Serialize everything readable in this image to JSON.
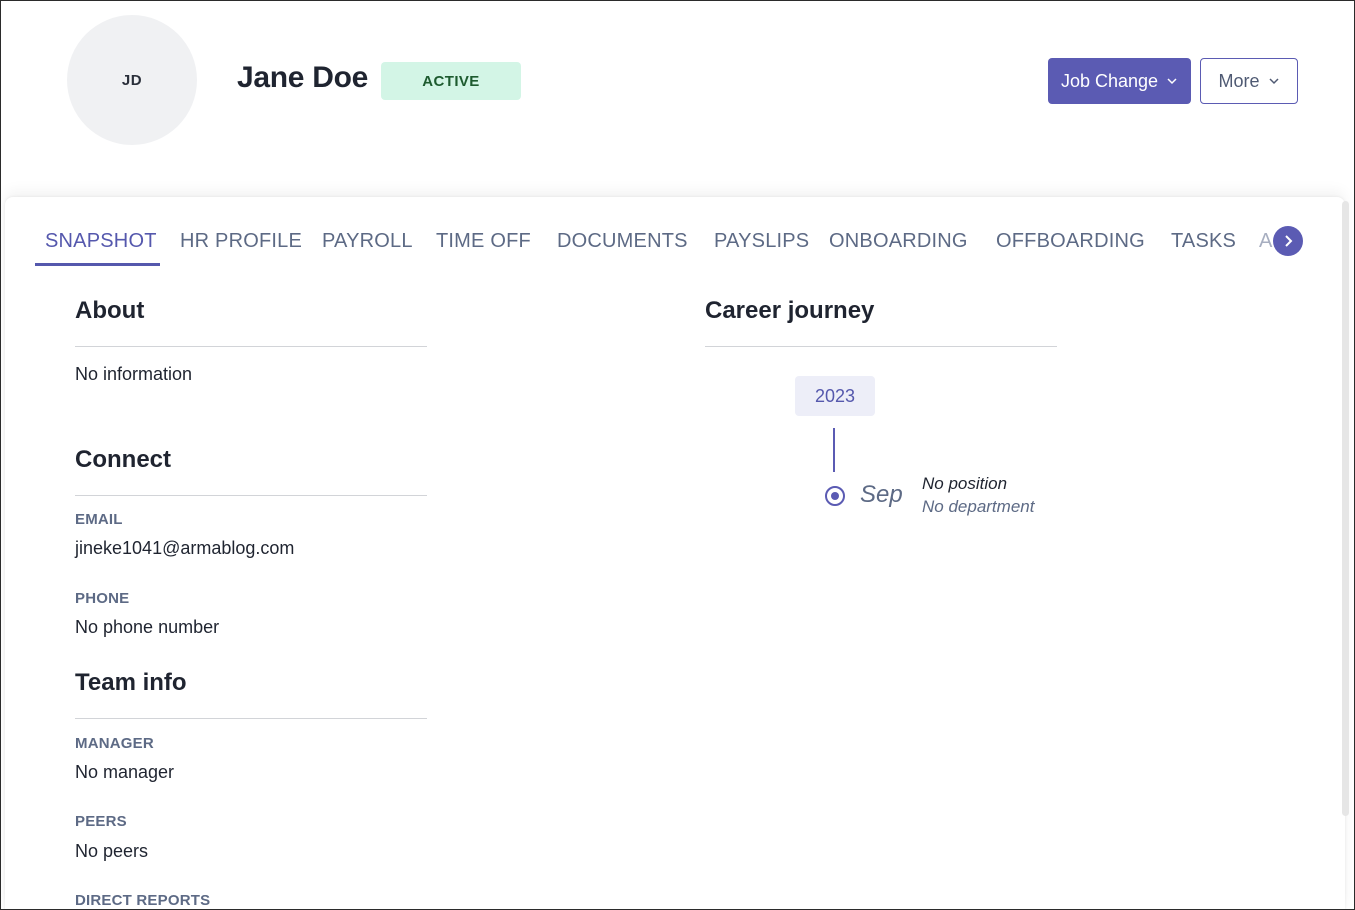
{
  "profile": {
    "initials": "JD",
    "name": "Jane Doe",
    "status": "ACTIVE",
    "status_color": "#d3f5e6",
    "accent_color": "#5b5bb3"
  },
  "actions": {
    "job_change_label": "Job Change",
    "more_label": "More"
  },
  "tabs": [
    {
      "label": "SNAPSHOT",
      "active": true
    },
    {
      "label": "HR PROFILE",
      "active": false
    },
    {
      "label": "PAYROLL",
      "active": false
    },
    {
      "label": "TIME OFF",
      "active": false
    },
    {
      "label": "DOCUMENTS",
      "active": false
    },
    {
      "label": "PAYSLIPS",
      "active": false
    },
    {
      "label": "ONBOARDING",
      "active": false
    },
    {
      "label": "OFFBOARDING",
      "active": false
    },
    {
      "label": "TASKS",
      "active": false
    },
    {
      "label": "A",
      "active": false
    }
  ],
  "about": {
    "title": "About",
    "text": "No information"
  },
  "connect": {
    "title": "Connect",
    "email_label": "EMAIL",
    "email_value": "jineke1041@armablog.com",
    "phone_label": "PHONE",
    "phone_value": "No phone number"
  },
  "team": {
    "title": "Team info",
    "manager_label": "MANAGER",
    "manager_value": "No manager",
    "peers_label": "PEERS",
    "peers_value": "No peers",
    "direct_reports_label": "DIRECT REPORTS"
  },
  "career": {
    "title": "Career journey",
    "year": "2023",
    "month": "Sep",
    "position": "No position",
    "department": "No department"
  }
}
